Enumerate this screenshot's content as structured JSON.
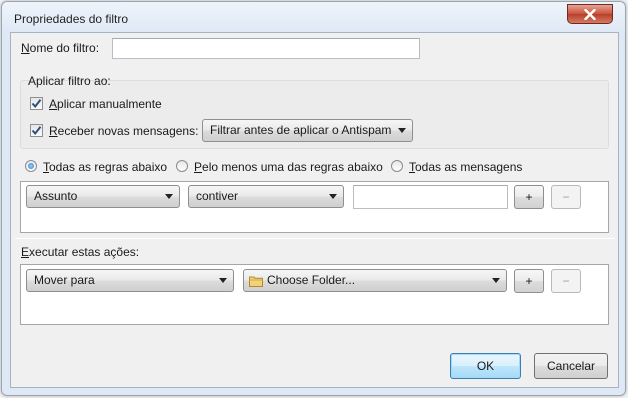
{
  "window": {
    "title": "Propriedades do filtro"
  },
  "filter_name": {
    "label": "Nome do filtro:",
    "value": ""
  },
  "apply_group": {
    "legend": "Aplicar filtro ao:",
    "manual": {
      "label": "Aplicar manualmente",
      "checked": true
    },
    "receive": {
      "label": "Receber novas mensagens:",
      "checked": true
    },
    "timing_select": {
      "value": "Filtrar antes de aplicar o Antispam"
    }
  },
  "match_options": [
    {
      "label": "Todas as regras abaixo",
      "selected": true
    },
    {
      "label": "Pelo menos uma das regras abaixo",
      "selected": false
    },
    {
      "label": "Todas as mensagens",
      "selected": false
    }
  ],
  "rule": {
    "field": "Assunto",
    "operator": "contiver",
    "value": "",
    "add": "+",
    "remove": "−"
  },
  "actions": {
    "label": "Executar estas ações:",
    "action": "Mover para",
    "target": "Choose Folder...",
    "add": "+",
    "remove": "−"
  },
  "buttons": {
    "ok": "OK",
    "cancel": "Cancelar"
  },
  "icons": {
    "close": "close-icon",
    "checkmark": "checkmark-icon",
    "folder": "folder-icon",
    "dropdown": "chevron-down-icon"
  },
  "colors": {
    "close_button": "#c8533c",
    "default_button": "#3c7fb1"
  }
}
